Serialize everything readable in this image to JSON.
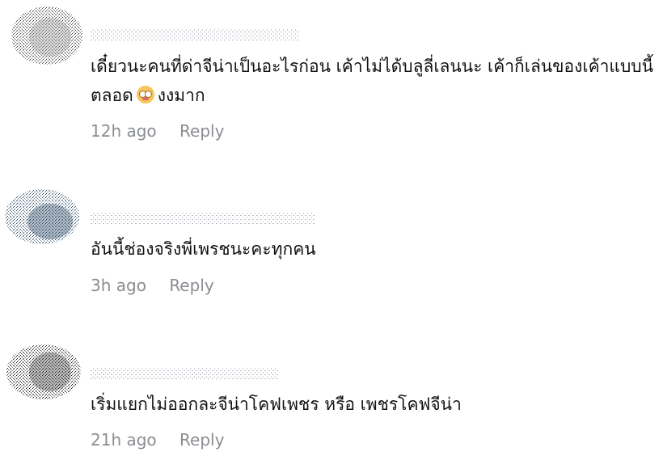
{
  "comments": [
    {
      "text": "เดี๋ยวนะคนที่ด่าจีน่าเป็นอะไรก่อน เค้าไม่ได้บลูลี่เลนนะ เค้าก็เล่นของเค้าแบบนี้ตลอด",
      "emoji": "flushed-face-emoji",
      "text_tail": "งงมาก",
      "time": "12h ago",
      "reply": "Reply"
    },
    {
      "text": "อันนี้ช่องจริงพี่เพรชนะคะทุกคน",
      "time": "3h ago",
      "reply": "Reply"
    },
    {
      "text": "เริ่มแยกไม่ออกละจีน่าโคฟเพชร หรือ เพชรโคฟจีน่า",
      "time": "21h ago",
      "reply": "Reply"
    }
  ],
  "colors": {
    "text": "#111111",
    "meta": "#8a8d91",
    "background": "#ffffff"
  }
}
